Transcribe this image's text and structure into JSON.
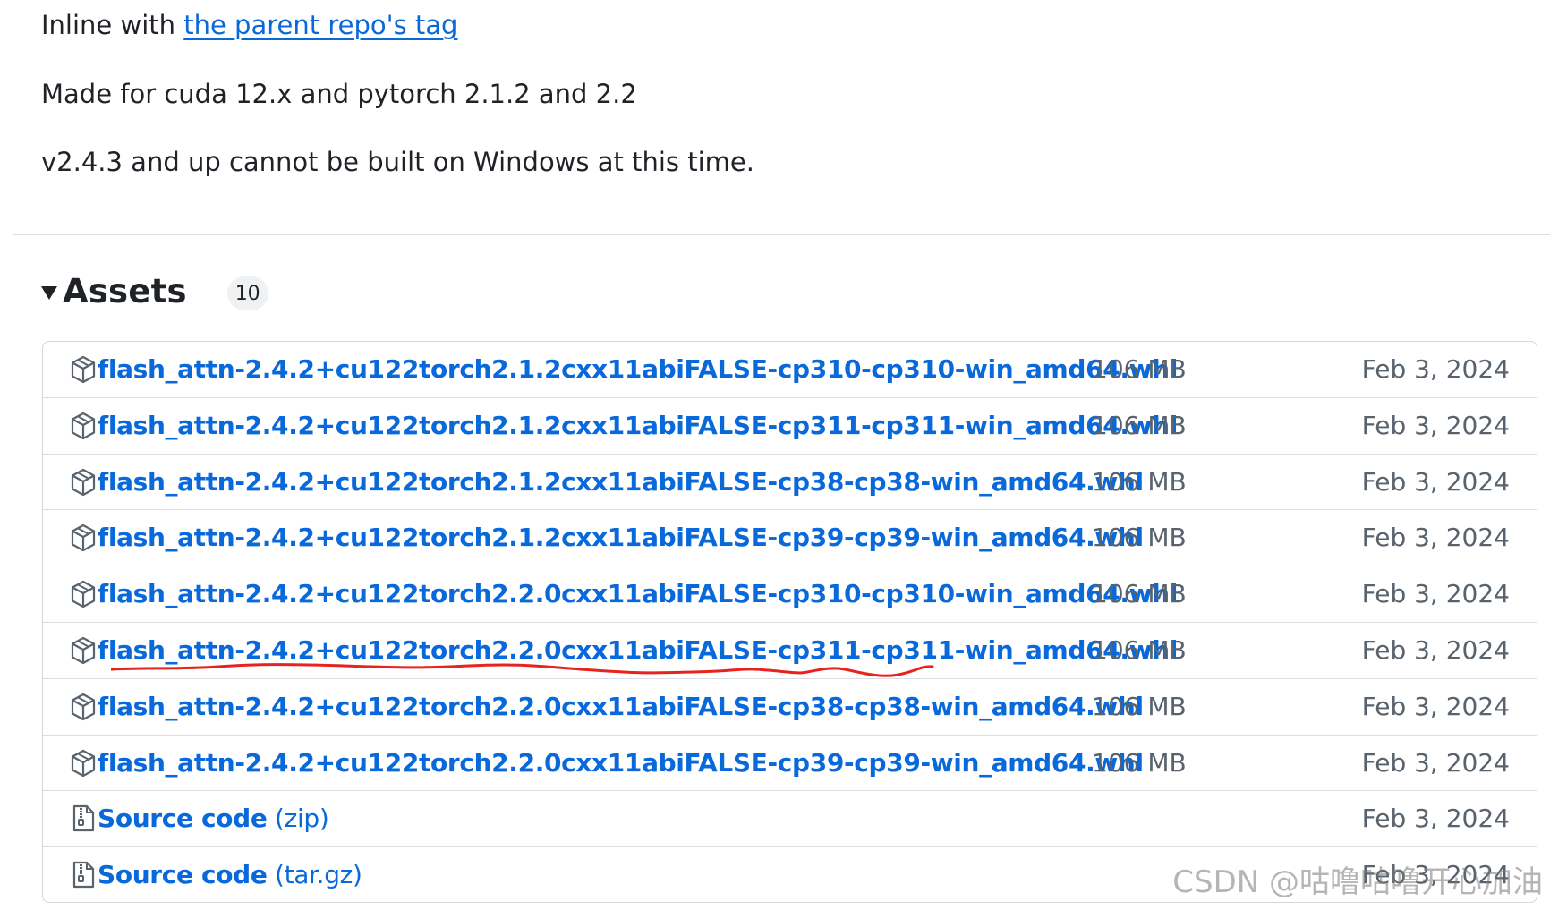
{
  "release_notes": {
    "line1_prefix": "Inline with ",
    "line1_link": "the parent repo's tag",
    "line2": "Made for cuda 12.x and pytorch 2.1.2 and 2.2",
    "line3": "v2.4.3 and up cannot be built on Windows at this time."
  },
  "assets": {
    "title": "Assets",
    "count": "10",
    "items": [
      {
        "name": "flash_attn-2.4.2+cu122torch2.1.2cxx11abiFALSE-cp310-cp310-win_amd64.whl",
        "suffix": "",
        "size": "106 MB",
        "date": "Feb 3, 2024",
        "icon": "package-icon"
      },
      {
        "name": "flash_attn-2.4.2+cu122torch2.1.2cxx11abiFALSE-cp311-cp311-win_amd64.whl",
        "suffix": "",
        "size": "106 MB",
        "date": "Feb 3, 2024",
        "icon": "package-icon"
      },
      {
        "name": "flash_attn-2.4.2+cu122torch2.1.2cxx11abiFALSE-cp38-cp38-win_amd64.whl",
        "suffix": "",
        "size": "106 MB",
        "date": "Feb 3, 2024",
        "icon": "package-icon"
      },
      {
        "name": "flash_attn-2.4.2+cu122torch2.1.2cxx11abiFALSE-cp39-cp39-win_amd64.whl",
        "suffix": "",
        "size": "106 MB",
        "date": "Feb 3, 2024",
        "icon": "package-icon"
      },
      {
        "name": "flash_attn-2.4.2+cu122torch2.2.0cxx11abiFALSE-cp310-cp310-win_amd64.whl",
        "suffix": "",
        "size": "106 MB",
        "date": "Feb 3, 2024",
        "icon": "package-icon"
      },
      {
        "name": "flash_attn-2.4.2+cu122torch2.2.0cxx11abiFALSE-cp311-cp311-win_amd64.whl",
        "suffix": "",
        "size": "106 MB",
        "date": "Feb 3, 2024",
        "icon": "package-icon"
      },
      {
        "name": "flash_attn-2.4.2+cu122torch2.2.0cxx11abiFALSE-cp38-cp38-win_amd64.whl",
        "suffix": "",
        "size": "106 MB",
        "date": "Feb 3, 2024",
        "icon": "package-icon"
      },
      {
        "name": "flash_attn-2.4.2+cu122torch2.2.0cxx11abiFALSE-cp39-cp39-win_amd64.whl",
        "suffix": "",
        "size": "106 MB",
        "date": "Feb 3, 2024",
        "icon": "package-icon"
      },
      {
        "name": "Source code",
        "suffix": " (zip)",
        "size": "",
        "date": "Feb 3, 2024",
        "icon": "file-zip-icon"
      },
      {
        "name": "Source code",
        "suffix": " (tar.gz)",
        "size": "",
        "date": "Feb 3, 2024",
        "icon": "file-zip-icon"
      }
    ]
  },
  "annotation": {
    "highlighted_row": 6,
    "color": "#e8231f"
  },
  "watermark": "CSDN @咕噜咕噜开心加油",
  "colors": {
    "link": "#0969da",
    "text": "#1f2328",
    "muted": "#59636e",
    "border": "#d0d7de"
  }
}
